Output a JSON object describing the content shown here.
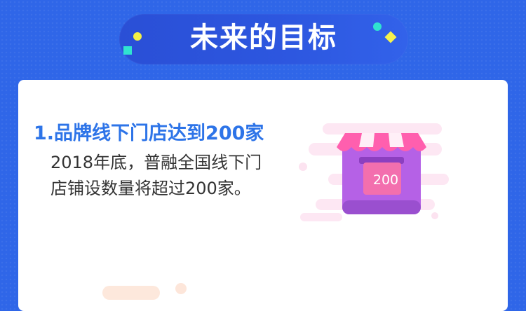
{
  "header": {
    "title": "未来的目标"
  },
  "goal": {
    "title": "1.品牌线下门店达到200家",
    "body": "2018年底，普融全国线下门店铺设数量将超过200家。"
  },
  "illustration": {
    "badge_text": "200",
    "icon": "storefront-icon"
  },
  "colors": {
    "background": "#2f66e8",
    "title_accent": "#2d74e8",
    "text": "#333333",
    "store_purple": "#b561e6",
    "awning_pink": "#ff5fae"
  }
}
